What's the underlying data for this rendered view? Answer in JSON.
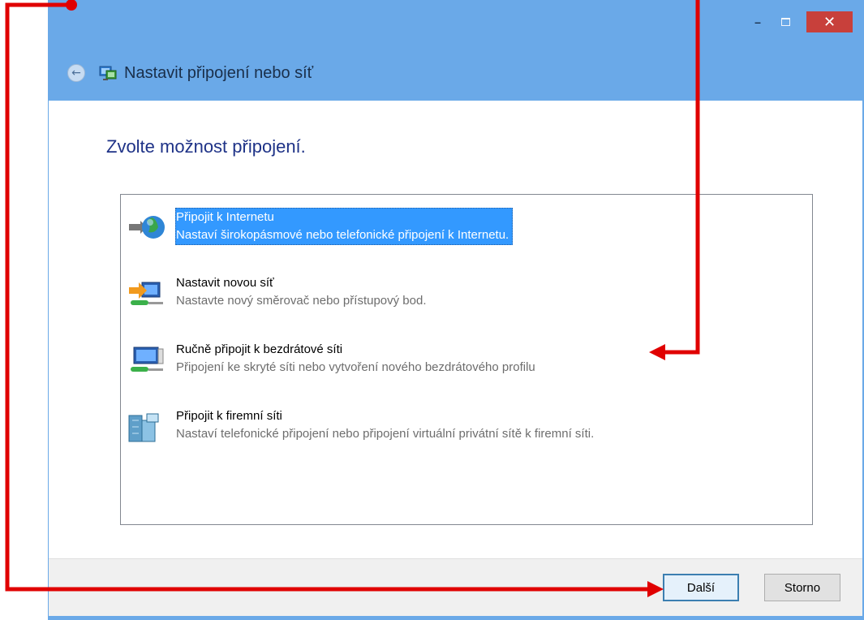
{
  "window": {
    "title": "Nastavit připojení nebo síť",
    "controls": {
      "minimize": "–",
      "maximize": "□",
      "close": "✕"
    }
  },
  "main": {
    "heading": "Zvolte možnost připojení.",
    "options": [
      {
        "title": "Připojit k Internetu",
        "description": "Nastaví širokopásmové nebo telefonické připojení k Internetu.",
        "icon": "globe-connection-icon",
        "selected": true
      },
      {
        "title": "Nastavit novou síť",
        "description": "Nastavte nový směrovač nebo přístupový bod.",
        "icon": "new-network-icon",
        "selected": false
      },
      {
        "title": "Ručně připojit k bezdrátové síti",
        "description": "Připojení ke skryté síti nebo vytvoření nového bezdrátového profilu",
        "icon": "wireless-network-icon",
        "selected": false
      },
      {
        "title": "Připojit k firemní síti",
        "description": "Nastaví telefonické připojení nebo připojení virtuální privátní sítě k firemní síti.",
        "icon": "workplace-network-icon",
        "selected": false
      }
    ]
  },
  "footer": {
    "next_label": "Další",
    "cancel_label": "Storno"
  },
  "colors": {
    "accent": "#6aa9e8",
    "selection": "#3399ff",
    "annotation": "#e00000",
    "heading": "#1e3287"
  }
}
